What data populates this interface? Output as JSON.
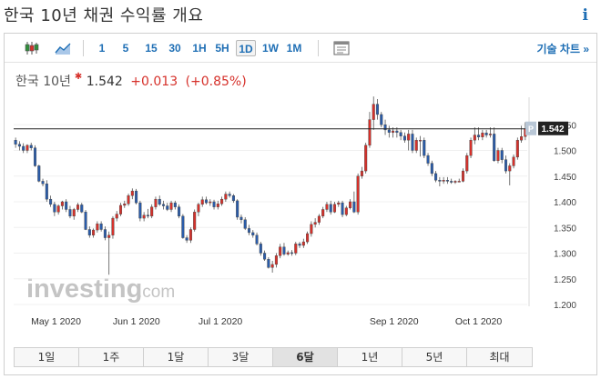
{
  "header": {
    "title": "한국 10년 채권 수익률 개요",
    "info_icon": "info-icon"
  },
  "toolbar": {
    "chart_type_icons": [
      "candlestick-icon",
      "line-chart-icon"
    ],
    "intervals": [
      "1",
      "5",
      "15",
      "30",
      "1H",
      "5H",
      "1D",
      "1W",
      "1M"
    ],
    "active_interval": "1D",
    "indicators_icon": "indicators-icon",
    "full_chart_label": "기술 차트 »"
  },
  "quote": {
    "name": "한국 10년",
    "price": "1.542",
    "change": "+0.013",
    "change_pct": "(+0.85%)",
    "change_color": "#d6312b"
  },
  "watermark": {
    "brand": "investing",
    "domain": ".com"
  },
  "chart_data": {
    "type": "candlestick",
    "x": [
      "2020-04-27",
      "2020-04-28",
      "2020-04-29",
      "2020-04-30",
      "2020-05-01",
      "2020-05-04",
      "2020-05-05",
      "2020-05-06",
      "2020-05-07",
      "2020-05-08",
      "2020-05-11",
      "2020-05-12",
      "2020-05-13",
      "2020-05-14",
      "2020-05-15",
      "2020-05-18",
      "2020-05-19",
      "2020-05-20",
      "2020-05-21",
      "2020-05-22",
      "2020-05-25",
      "2020-05-26",
      "2020-05-27",
      "2020-05-28",
      "2020-05-29",
      "2020-06-01",
      "2020-06-02",
      "2020-06-03",
      "2020-06-04",
      "2020-06-05",
      "2020-06-08",
      "2020-06-09",
      "2020-06-10",
      "2020-06-11",
      "2020-06-12",
      "2020-06-15",
      "2020-06-16",
      "2020-06-17",
      "2020-06-18",
      "2020-06-19",
      "2020-06-22",
      "2020-06-23",
      "2020-06-24",
      "2020-06-25",
      "2020-06-26",
      "2020-06-29",
      "2020-06-30",
      "2020-07-01",
      "2020-07-02",
      "2020-07-03",
      "2020-07-06",
      "2020-07-07",
      "2020-07-08",
      "2020-07-09",
      "2020-07-10",
      "2020-07-13",
      "2020-07-14",
      "2020-07-15",
      "2020-07-16",
      "2020-07-17",
      "2020-07-20",
      "2020-07-21",
      "2020-07-22",
      "2020-07-23",
      "2020-07-24",
      "2020-07-27",
      "2020-07-28",
      "2020-07-29",
      "2020-07-30",
      "2020-07-31",
      "2020-08-03",
      "2020-08-04",
      "2020-08-05",
      "2020-08-06",
      "2020-08-07",
      "2020-08-10",
      "2020-08-11",
      "2020-08-12",
      "2020-08-13",
      "2020-08-14",
      "2020-08-17",
      "2020-08-18",
      "2020-08-19",
      "2020-08-20",
      "2020-08-21",
      "2020-08-24",
      "2020-08-25",
      "2020-08-26",
      "2020-08-27",
      "2020-08-28",
      "2020-08-31",
      "2020-09-01",
      "2020-09-02",
      "2020-09-03",
      "2020-09-04",
      "2020-09-07",
      "2020-09-08",
      "2020-09-09",
      "2020-09-10",
      "2020-09-11",
      "2020-09-14",
      "2020-09-15",
      "2020-09-16",
      "2020-09-17",
      "2020-09-18",
      "2020-09-21",
      "2020-09-22",
      "2020-09-23",
      "2020-09-24",
      "2020-09-25",
      "2020-09-28",
      "2020-09-29",
      "2020-09-30",
      "2020-10-01",
      "2020-10-02",
      "2020-10-05",
      "2020-10-06",
      "2020-10-07",
      "2020-10-08",
      "2020-10-09",
      "2020-10-12",
      "2020-10-13",
      "2020-10-14",
      "2020-10-15",
      "2020-10-16",
      "2020-10-19",
      "2020-10-20",
      "2020-10-21",
      "2020-10-22",
      "2020-10-23",
      "2020-10-26",
      "2020-10-27"
    ],
    "open": [
      1.52,
      1.512,
      1.508,
      1.5,
      1.51,
      1.505,
      1.47,
      1.44,
      1.435,
      1.405,
      1.395,
      1.38,
      1.392,
      1.4,
      1.385,
      1.372,
      1.385,
      1.394,
      1.38,
      1.346,
      1.335,
      1.345,
      1.357,
      1.346,
      1.33,
      1.335,
      1.368,
      1.376,
      1.393,
      1.396,
      1.412,
      1.421,
      1.398,
      1.368,
      1.374,
      1.372,
      1.39,
      1.405,
      1.395,
      1.392,
      1.385,
      1.398,
      1.39,
      1.372,
      1.33,
      1.325,
      1.346,
      1.38,
      1.395,
      1.404,
      1.398,
      1.4,
      1.39,
      1.396,
      1.405,
      1.415,
      1.412,
      1.402,
      1.37,
      1.365,
      1.348,
      1.34,
      1.335,
      1.318,
      1.3,
      1.288,
      1.272,
      1.278,
      1.295,
      1.312,
      1.298,
      1.301,
      1.3,
      1.318,
      1.315,
      1.322,
      1.338,
      1.356,
      1.36,
      1.372,
      1.385,
      1.395,
      1.38,
      1.395,
      1.398,
      1.375,
      1.388,
      1.4,
      1.38,
      1.45,
      1.46,
      1.51,
      1.56,
      1.59,
      1.57,
      1.55,
      1.54,
      1.535,
      1.538,
      1.535,
      1.528,
      1.52,
      1.532,
      1.5,
      1.52,
      1.52,
      1.49,
      1.475,
      1.455,
      1.442,
      1.44,
      1.442,
      1.44,
      1.438,
      1.44,
      1.44,
      1.46,
      1.49,
      1.52,
      1.53,
      1.526,
      1.534,
      1.53,
      1.532,
      1.48,
      1.5,
      1.482,
      1.46,
      1.47,
      1.487,
      1.52,
      1.527
    ],
    "high": [
      1.525,
      1.518,
      1.514,
      1.512,
      1.515,
      1.51,
      1.472,
      1.445,
      1.442,
      1.412,
      1.4,
      1.395,
      1.402,
      1.405,
      1.392,
      1.388,
      1.398,
      1.398,
      1.384,
      1.352,
      1.348,
      1.362,
      1.362,
      1.352,
      1.342,
      1.372,
      1.382,
      1.398,
      1.402,
      1.416,
      1.426,
      1.425,
      1.402,
      1.38,
      1.386,
      1.395,
      1.41,
      1.412,
      1.402,
      1.398,
      1.402,
      1.402,
      1.395,
      1.376,
      1.335,
      1.35,
      1.385,
      1.398,
      1.41,
      1.41,
      1.405,
      1.404,
      1.402,
      1.41,
      1.42,
      1.42,
      1.415,
      1.405,
      1.375,
      1.37,
      1.355,
      1.345,
      1.34,
      1.322,
      1.305,
      1.292,
      1.285,
      1.3,
      1.318,
      1.32,
      1.305,
      1.306,
      1.322,
      1.322,
      1.328,
      1.342,
      1.362,
      1.368,
      1.376,
      1.39,
      1.4,
      1.402,
      1.4,
      1.402,
      1.402,
      1.392,
      1.405,
      1.42,
      1.455,
      1.468,
      1.515,
      1.575,
      1.605,
      1.6,
      1.575,
      1.56,
      1.548,
      1.545,
      1.545,
      1.54,
      1.535,
      1.54,
      1.54,
      1.525,
      1.528,
      1.525,
      1.495,
      1.48,
      1.46,
      1.448,
      1.448,
      1.448,
      1.445,
      1.442,
      1.445,
      1.465,
      1.495,
      1.525,
      1.545,
      1.545,
      1.54,
      1.54,
      1.545,
      1.545,
      1.505,
      1.505,
      1.49,
      1.475,
      1.492,
      1.525,
      1.548,
      1.555
    ],
    "low": [
      1.505,
      1.5,
      1.495,
      1.495,
      1.5,
      1.468,
      1.438,
      1.43,
      1.4,
      1.39,
      1.372,
      1.375,
      1.385,
      1.38,
      1.368,
      1.365,
      1.38,
      1.378,
      1.345,
      1.33,
      1.33,
      1.34,
      1.342,
      1.325,
      1.258,
      1.328,
      1.362,
      1.372,
      1.388,
      1.392,
      1.405,
      1.395,
      1.362,
      1.362,
      1.368,
      1.368,
      1.385,
      1.392,
      1.385,
      1.382,
      1.38,
      1.385,
      1.368,
      1.328,
      1.32,
      1.32,
      1.342,
      1.372,
      1.39,
      1.395,
      1.392,
      1.385,
      1.385,
      1.392,
      1.4,
      1.408,
      1.398,
      1.365,
      1.358,
      1.345,
      1.335,
      1.33,
      1.315,
      1.295,
      1.285,
      1.27,
      1.262,
      1.272,
      1.29,
      1.295,
      1.295,
      1.295,
      1.296,
      1.31,
      1.31,
      1.318,
      1.332,
      1.35,
      1.355,
      1.368,
      1.38,
      1.375,
      1.378,
      1.39,
      1.37,
      1.372,
      1.385,
      1.378,
      1.375,
      1.445,
      1.455,
      1.505,
      1.54,
      1.56,
      1.545,
      1.53,
      1.525,
      1.525,
      1.525,
      1.52,
      1.515,
      1.5,
      1.495,
      1.495,
      1.488,
      1.485,
      1.47,
      1.45,
      1.438,
      1.43,
      1.435,
      1.435,
      1.435,
      1.435,
      1.438,
      1.438,
      1.455,
      1.485,
      1.512,
      1.52,
      1.52,
      1.525,
      1.525,
      1.478,
      1.475,
      1.475,
      1.455,
      1.432,
      1.465,
      1.482,
      1.515,
      1.52
    ],
    "close": [
      1.512,
      1.508,
      1.5,
      1.51,
      1.505,
      1.47,
      1.44,
      1.435,
      1.405,
      1.395,
      1.38,
      1.392,
      1.4,
      1.385,
      1.372,
      1.385,
      1.394,
      1.38,
      1.346,
      1.335,
      1.345,
      1.357,
      1.346,
      1.33,
      1.335,
      1.368,
      1.376,
      1.393,
      1.396,
      1.412,
      1.421,
      1.398,
      1.368,
      1.374,
      1.372,
      1.39,
      1.405,
      1.395,
      1.392,
      1.385,
      1.398,
      1.39,
      1.372,
      1.33,
      1.325,
      1.346,
      1.38,
      1.395,
      1.404,
      1.398,
      1.4,
      1.39,
      1.396,
      1.405,
      1.415,
      1.412,
      1.402,
      1.37,
      1.365,
      1.348,
      1.34,
      1.335,
      1.318,
      1.3,
      1.288,
      1.272,
      1.278,
      1.295,
      1.312,
      1.298,
      1.301,
      1.3,
      1.318,
      1.315,
      1.322,
      1.338,
      1.356,
      1.36,
      1.372,
      1.385,
      1.395,
      1.38,
      1.395,
      1.398,
      1.375,
      1.388,
      1.4,
      1.38,
      1.45,
      1.46,
      1.51,
      1.56,
      1.59,
      1.57,
      1.55,
      1.54,
      1.535,
      1.538,
      1.535,
      1.528,
      1.52,
      1.532,
      1.5,
      1.52,
      1.52,
      1.49,
      1.475,
      1.455,
      1.442,
      1.44,
      1.442,
      1.44,
      1.438,
      1.44,
      1.44,
      1.46,
      1.49,
      1.52,
      1.53,
      1.526,
      1.534,
      1.53,
      1.532,
      1.48,
      1.5,
      1.482,
      1.46,
      1.47,
      1.487,
      1.52,
      1.527,
      1.542
    ],
    "y_ticks": [
      "1.550",
      "1.500",
      "1.450",
      "1.400",
      "1.350",
      "1.300",
      "1.250",
      "1.200"
    ],
    "ylim": [
      1.2,
      1.6
    ],
    "x_ticks": [
      {
        "label": "May 1 2020",
        "date": "2020-05-01"
      },
      {
        "label": "Jun 1 2020",
        "date": "2020-06-01"
      },
      {
        "label": "Jul 1 2020",
        "date": "2020-07-01"
      },
      {
        "label": "Aug 1 2020",
        "date": "2020-08-01"
      },
      {
        "label": "Sep 1 2020",
        "date": "2020-09-01"
      },
      {
        "label": "Oct 1 2020",
        "date": "2020-10-01"
      }
    ],
    "last_price_label": "1.542",
    "last_price": 1.542,
    "marker_label": "P",
    "up_color": "#d6312b",
    "down_color": "#2a5caa",
    "grid": true
  },
  "ranges": {
    "buttons": [
      "1일",
      "1주",
      "1달",
      "3달",
      "6달",
      "1년",
      "5년",
      "최대"
    ],
    "active": "6달"
  }
}
